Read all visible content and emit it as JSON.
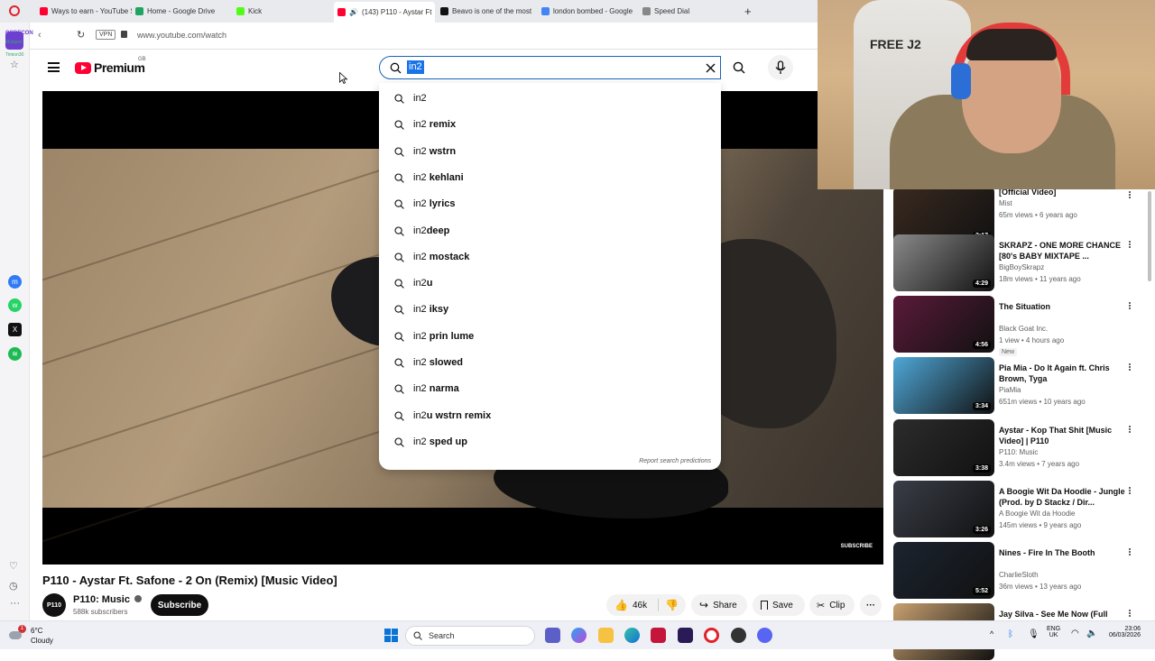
{
  "browser": {
    "tabs": [
      {
        "label": "Ways to earn - YouTube St",
        "color": "#ff0033"
      },
      {
        "label": "Home - Google Drive",
        "color": "#1fa463"
      },
      {
        "label": "Kick",
        "color": "#53fc18"
      },
      {
        "label": "(143) P110 - Aystar Ft",
        "color": "#ff0033"
      },
      {
        "label": "Beavo is one of the most",
        "color": "#111111"
      },
      {
        "label": "london bombed - Google",
        "color": "#4285f4"
      },
      {
        "label": "Speed Dial",
        "color": "#888888"
      }
    ],
    "url": "www.youtube.com/watch",
    "vpn_label": "VPN",
    "new_tab": "+",
    "sidebar_labels": [
      "CODECON",
      "Mobizen",
      "Timion30"
    ]
  },
  "header": {
    "logo_text": "Premium",
    "logo_region": "GB",
    "search_value": "in2"
  },
  "suggestions": {
    "items": [
      {
        "prefix": "in2",
        "rest": ""
      },
      {
        "prefix": "in2",
        "rest": " remix"
      },
      {
        "prefix": "in2",
        "rest": " wstrn"
      },
      {
        "prefix": "in2",
        "rest": " kehlani"
      },
      {
        "prefix": "in2",
        "rest": " lyrics"
      },
      {
        "prefix": "in2",
        "rest": "deep"
      },
      {
        "prefix": "in2",
        "rest": " mostack"
      },
      {
        "prefix": "in2",
        "rest": "u"
      },
      {
        "prefix": "in2",
        "rest": " iksy"
      },
      {
        "prefix": "in2",
        "rest": " prin lume"
      },
      {
        "prefix": "in2",
        "rest": " slowed"
      },
      {
        "prefix": "in2",
        "rest": " narma"
      },
      {
        "prefix": "in2",
        "rest": "u wstrn remix"
      },
      {
        "prefix": "in2",
        "rest": " sped up"
      }
    ],
    "report": "Report search predictions"
  },
  "player": {
    "watermark": "SUBSCRIBE"
  },
  "video": {
    "title": "P110 - Aystar Ft. Safone - 2 On (Remix) [Music Video]",
    "channel": "P110: Music",
    "subscribers": "588k subscribers",
    "avatar_text": "P110",
    "subscribe_label": "Subscribe",
    "likes": "46k",
    "share_label": "Share",
    "save_label": "Save",
    "clip_label": "Clip"
  },
  "recommendations": [
    {
      "title": "[Official Video]",
      "channel": "Mist",
      "meta": "65m views • 6 years ago",
      "duration": "3:17",
      "new": "",
      "color": "#3a2a20"
    },
    {
      "title": "SKRAPZ - ONE MORE CHANCE [80's BABY MIXTAPE ...",
      "channel": "BigBoySkrapz",
      "meta": "18m views • 11 years ago",
      "duration": "4:29",
      "new": "",
      "color": "#8a8a8a"
    },
    {
      "title": "The Situation",
      "channel": "Black Goat Inc.",
      "meta": "1 view • 4 hours ago",
      "duration": "4:56",
      "new": "New",
      "color": "#5a1a3a"
    },
    {
      "title": "Pia Mia - Do It Again ft. Chris Brown, Tyga",
      "channel": "PiaMia",
      "meta": "651m views • 10 years ago",
      "duration": "3:34",
      "new": "",
      "color": "#4fa8d8"
    },
    {
      "title": "Aystar - Kop That Shit [Music Video] | P110",
      "channel": "P110: Music",
      "meta": "3.4m views • 7 years ago",
      "duration": "3:38",
      "new": "",
      "color": "#2c2c2c"
    },
    {
      "title": "A Boogie Wit Da Hoodie - Jungle (Prod. by D Stackz / Dir...",
      "channel": "A Boogie Wit da Hoodie",
      "meta": "145m views • 9 years ago",
      "duration": "3:26",
      "new": "",
      "color": "#3a3d48"
    },
    {
      "title": "Nines - Fire In The Booth",
      "channel": "CharlieSloth",
      "meta": "36m views • 13 years ago",
      "duration": "5:52",
      "new": "",
      "color": "#1c2430"
    },
    {
      "title": "Jay Silva - See Me Now (Full",
      "channel": "",
      "meta": "",
      "duration": "",
      "new": "",
      "color": "#c8a070"
    }
  ],
  "webcam": {
    "shirt_text": "FREE J2"
  },
  "taskbar": {
    "weather_temp": "6°C",
    "weather_desc": "Cloudy",
    "search_placeholder": "Search",
    "lang": "ENG",
    "region": "UK",
    "time": "23:06",
    "date": "06/03/2026",
    "notif_count": "1"
  }
}
